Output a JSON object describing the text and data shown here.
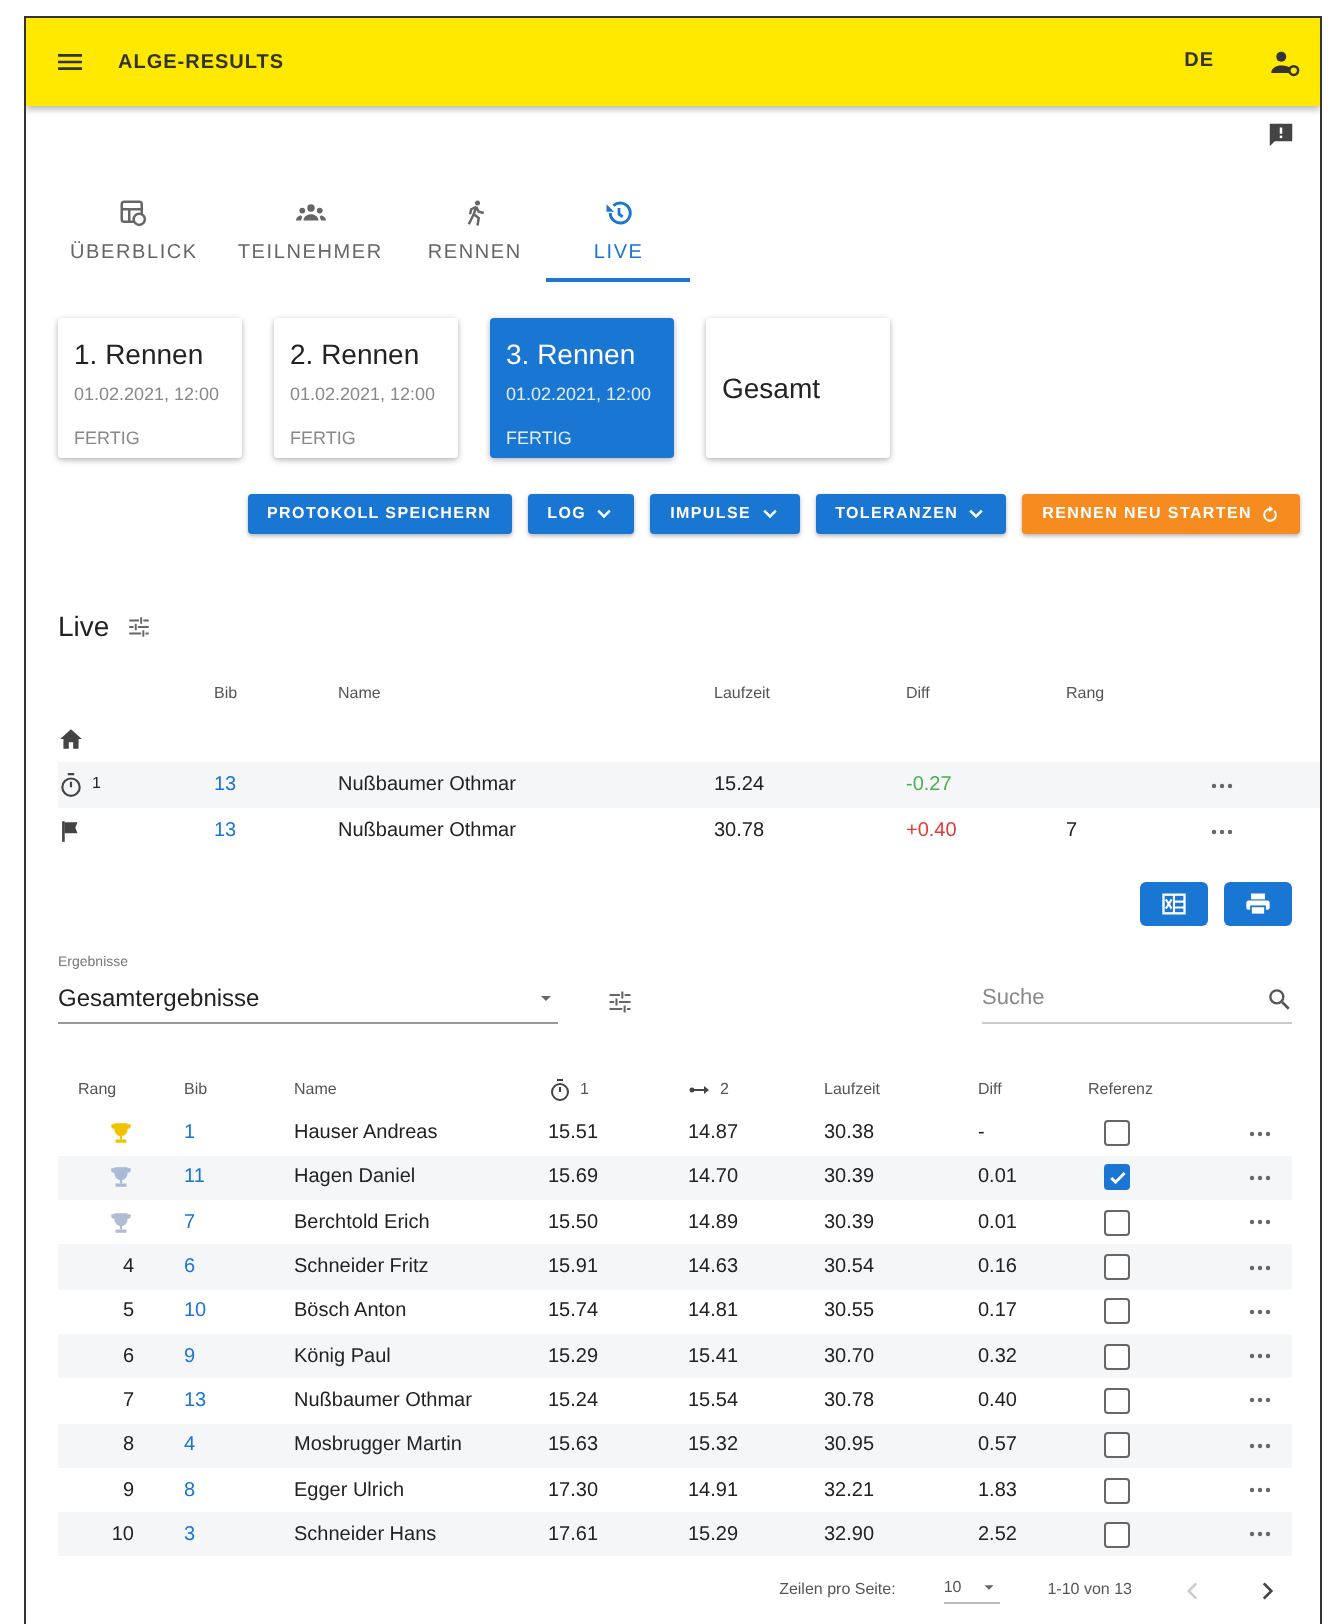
{
  "app_bar": {
    "title": "ALGE-RESULTS",
    "language": "DE"
  },
  "tabs": [
    {
      "label": "ÜBERBLICK",
      "selected": false
    },
    {
      "label": "TEILNEHMER",
      "selected": false
    },
    {
      "label": "RENNEN",
      "selected": false
    },
    {
      "label": "LIVE",
      "selected": true
    }
  ],
  "races": [
    {
      "title": "1. Rennen",
      "date": "01.02.2021, 12:00",
      "status": "FERTIG",
      "selected": false
    },
    {
      "title": "2. Rennen",
      "date": "01.02.2021, 12:00",
      "status": "FERTIG",
      "selected": false
    },
    {
      "title": "3. Rennen",
      "date": "01.02.2021, 12:00",
      "status": "FERTIG",
      "selected": true
    },
    {
      "title": "Gesamt",
      "selected": false
    }
  ],
  "actions": [
    {
      "label": "PROTOKOLL SPEICHERN",
      "kind": "plain"
    },
    {
      "label": "LOG",
      "kind": "dropdown"
    },
    {
      "label": "IMPULSE",
      "kind": "dropdown"
    },
    {
      "label": "TOLERANZEN",
      "kind": "dropdown"
    },
    {
      "label": "RENNEN NEU STARTEN",
      "kind": "restart"
    }
  ],
  "live": {
    "title": "Live",
    "columns": [
      "Bib",
      "Name",
      "Laufzeit",
      "Diff",
      "Rang"
    ],
    "rows": [
      {
        "kind": "start"
      },
      {
        "kind": "split",
        "split": "1",
        "bib": "13",
        "name": "Nußbaumer Othmar",
        "time": "15.24",
        "diff": "-0.27",
        "color": "#4caf50"
      },
      {
        "kind": "finish",
        "bib": "13",
        "name": "Nußbaumer Othmar",
        "time": "30.78",
        "diff": "+0.40",
        "color": "#e53935",
        "rank": "7"
      }
    ]
  },
  "results": {
    "select_label": "Ergebnisse",
    "select_value": "Gesamtergebnisse",
    "search_placeholder": "Suche",
    "columns": [
      {
        "label": "Rang",
        "kind": "text"
      },
      {
        "label": "Bib",
        "kind": "text"
      },
      {
        "label": "Name",
        "kind": "text"
      },
      {
        "label": "1",
        "kind": "stopwatch"
      },
      {
        "label": "2",
        "kind": "distance"
      },
      {
        "label": "Laufzeit",
        "kind": "text"
      },
      {
        "label": "Diff",
        "kind": "text"
      },
      {
        "label": "Referenz",
        "kind": "text"
      }
    ],
    "rows": [
      {
        "kind": "trophy",
        "color": "#f2c200",
        "bib": "1",
        "name": "Hauser Andreas",
        "t1": "15.51",
        "t2": "14.87",
        "time": "30.38",
        "diff": "-",
        "checked": false
      },
      {
        "kind": "trophy",
        "color": "#a9b9d6",
        "bib": "11",
        "name": "Hagen Daniel",
        "t1": "15.69",
        "t2": "14.70",
        "time": "30.39",
        "diff": "0.01",
        "checked": true
      },
      {
        "kind": "trophy",
        "color": "#b2bdd2",
        "bib": "7",
        "name": "Berchtold Erich",
        "t1": "15.50",
        "t2": "14.89",
        "time": "30.39",
        "diff": "0.01",
        "checked": false
      },
      {
        "kind": "number",
        "rank": "4",
        "bib": "6",
        "name": "Schneider Fritz",
        "t1": "15.91",
        "t2": "14.63",
        "time": "30.54",
        "diff": "0.16",
        "checked": false
      },
      {
        "kind": "number",
        "rank": "5",
        "bib": "10",
        "name": "Bösch Anton",
        "t1": "15.74",
        "t2": "14.81",
        "time": "30.55",
        "diff": "0.17",
        "checked": false
      },
      {
        "kind": "number",
        "rank": "6",
        "bib": "9",
        "name": "König Paul",
        "t1": "15.29",
        "t2": "15.41",
        "time": "30.70",
        "diff": "0.32",
        "checked": false
      },
      {
        "kind": "number",
        "rank": "7",
        "bib": "13",
        "name": "Nußbaumer Othmar",
        "t1": "15.24",
        "t2": "15.54",
        "time": "30.78",
        "diff": "0.40",
        "checked": false
      },
      {
        "kind": "number",
        "rank": "8",
        "bib": "4",
        "name": "Mosbrugger Martin",
        "t1": "15.63",
        "t2": "15.32",
        "time": "30.95",
        "diff": "0.57",
        "checked": false
      },
      {
        "kind": "number",
        "rank": "9",
        "bib": "8",
        "name": "Egger Ulrich",
        "t1": "17.30",
        "t2": "14.91",
        "time": "32.21",
        "diff": "1.83",
        "checked": false
      },
      {
        "kind": "number",
        "rank": "10",
        "bib": "3",
        "name": "Schneider Hans",
        "t1": "17.61",
        "t2": "15.29",
        "time": "32.90",
        "diff": "2.52",
        "checked": false
      }
    ]
  },
  "pagination": {
    "rows_label": "Zeilen pro Seite:",
    "rows_value": "10",
    "range": "1-10 von 13",
    "prev": {
      "disabled": true
    },
    "next": {
      "disabled": false
    }
  }
}
